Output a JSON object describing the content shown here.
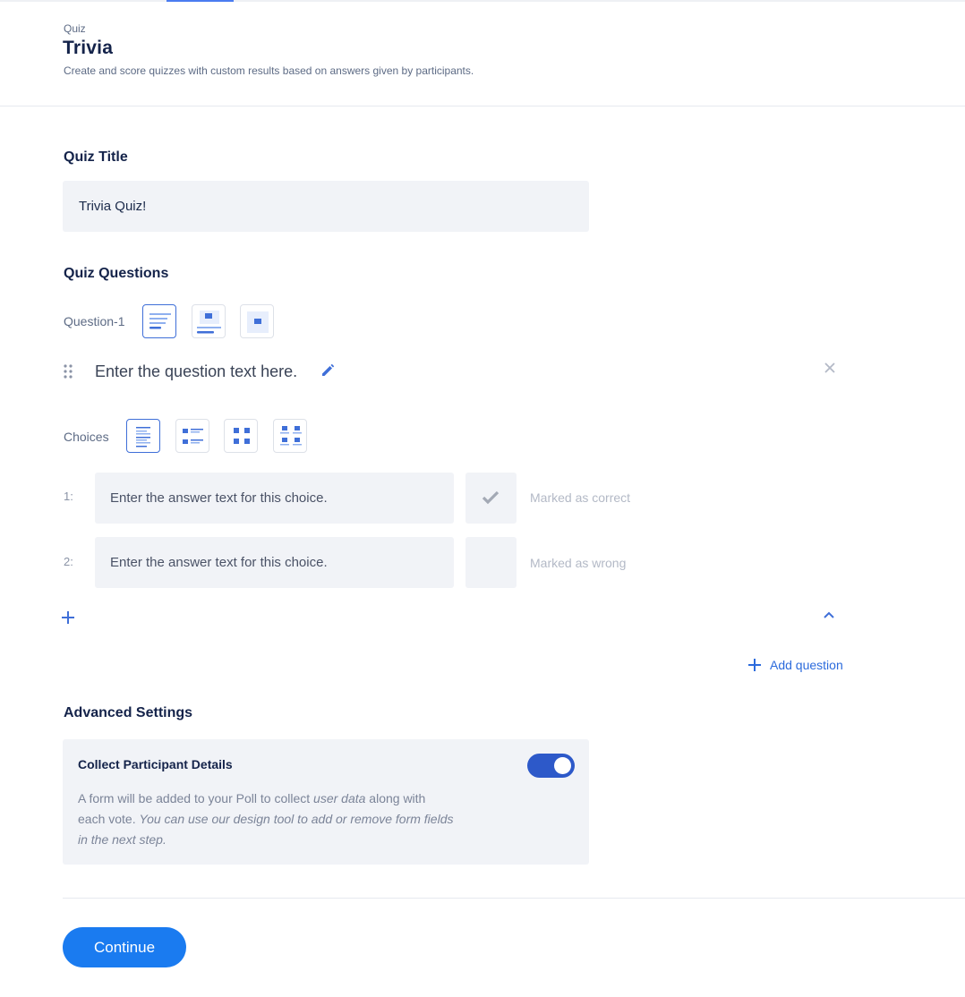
{
  "header": {
    "breadcrumb": "Quiz",
    "title": "Trivia",
    "subtitle": "Create and score quizzes with custom results based on answers given by participants."
  },
  "quiz_title": {
    "label": "Quiz Title",
    "value": "Trivia Quiz!"
  },
  "quiz_questions": {
    "label": "Quiz Questions",
    "question_label": "Question-1",
    "question_placeholder": "Enter the question text here.",
    "choices_label": "Choices",
    "choices": [
      {
        "number": "1:",
        "placeholder": "Enter the answer text for this choice.",
        "status": "Marked as correct"
      },
      {
        "number": "2:",
        "placeholder": "Enter the answer text for this choice.",
        "status": "Marked as wrong"
      }
    ],
    "add_question_label": "Add question"
  },
  "advanced_settings": {
    "label": "Advanced Settings",
    "collect_title": "Collect Participant Details",
    "desc_1": "A form will be added to your Poll to collect ",
    "desc_2": "user data",
    "desc_3": " along with each vote. ",
    "desc_4": "You can use our design tool to add or remove form fields in the next step.",
    "enabled": true
  },
  "continue_label": "Continue",
  "colors": {
    "accent": "#1a7bf0",
    "toggle_on": "#2d59c9",
    "link": "#2c6bdc"
  }
}
